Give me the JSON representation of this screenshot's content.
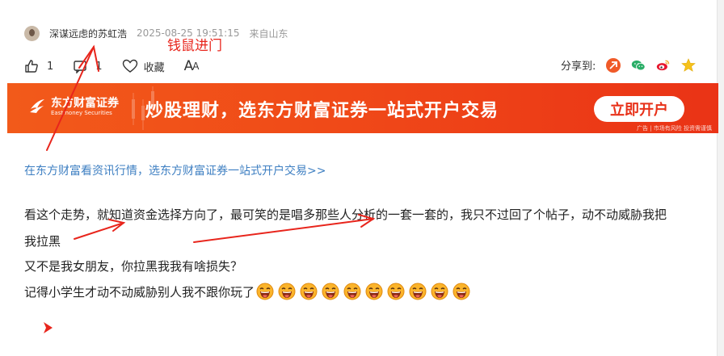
{
  "post": {
    "author": "深谋远虑的苏虹浩",
    "time": "2025-08-25 19:51:15",
    "location": "来自山东",
    "annotation": "钱鼠进门",
    "likes": "1",
    "comments": "1",
    "collect_label": "收藏",
    "font_label_big": "A",
    "font_label_small": "A",
    "share_label": "分享到:"
  },
  "banner": {
    "logo_cn": "东方财富证券",
    "logo_en": "Eastmoney Securities",
    "slogan": "炒股理财，选东方财富证券一站式开户交易",
    "button": "立即开户",
    "note": "广告 | 市场有风险 投资需谨慎"
  },
  "promo_link": "在东方财富看资讯行情，选东方财富证券一站式开户交易>>",
  "content": {
    "line1": "看这个走势，就知道资金选择方向了，最可笑的是唱多那些人分析的一套一套的，我只不过回了个帖子，动不动威胁我把",
    "line2": "我拉黑",
    "line3": "又不是我女朋友，你拉黑我我有啥损失？",
    "line4": "记得小学生才动不动威胁别人我不跟你玩了",
    "emoji_count": 10,
    "emoji": "laughing-face-icon"
  },
  "colors": {
    "annotation": "#e8251c",
    "link": "#3e7fc2",
    "banner": "#f04a18"
  }
}
